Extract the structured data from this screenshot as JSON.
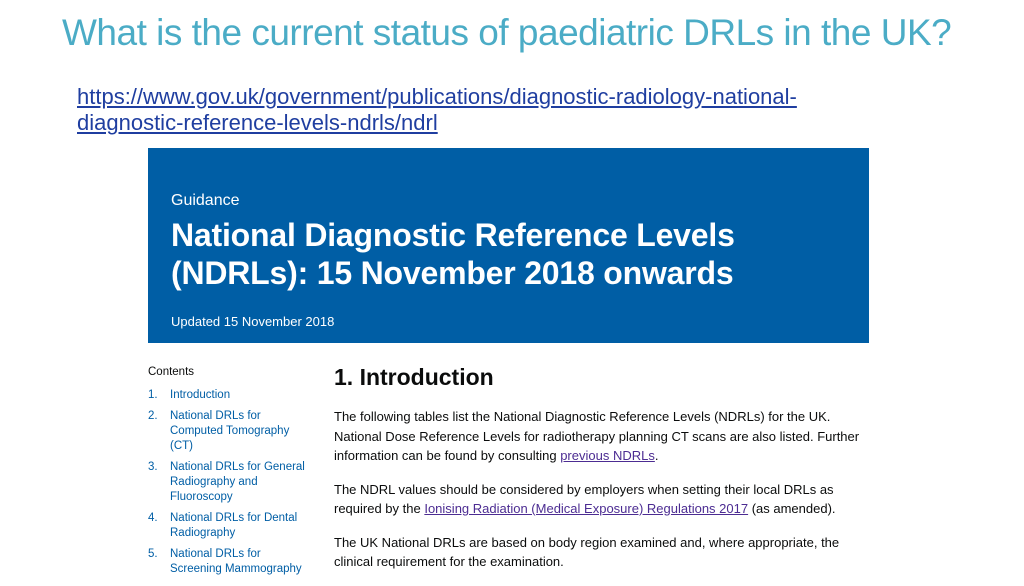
{
  "slide": {
    "title": "What is the current status of paediatric DRLs in the UK?",
    "link": "https://www.gov.uk/government/publications/diagnostic-radiology-national-diagnostic-reference-levels-ndrls/ndrl"
  },
  "banner": {
    "kicker": "Guidance",
    "title": "National Diagnostic Reference Levels (NDRLs): 15 November 2018 onwards",
    "updated": "Updated 15 November 2018",
    "color": "#005ea5"
  },
  "contents": {
    "heading": "Contents",
    "items": [
      {
        "num": "1.",
        "label": "Introduction"
      },
      {
        "num": "2.",
        "label": "National DRLs for Computed Tomography (CT)"
      },
      {
        "num": "3.",
        "label": "National DRLs for General Radiography and Fluoroscopy"
      },
      {
        "num": "4.",
        "label": "National DRLs for Dental Radiography"
      },
      {
        "num": "5.",
        "label": "National DRLs for Screening Mammography"
      }
    ]
  },
  "main": {
    "heading": "1. Introduction",
    "p1_text": "The following tables list the National Diagnostic Reference Levels (NDRLs) for the UK. National Dose Reference Levels for radiotherapy planning CT scans are also listed. Further information can be found by consulting ",
    "p1_link": "previous NDRLs",
    "p1_end": ".",
    "p2_text": "The NDRL values should be considered by employers when setting their local DRLs as required by the ",
    "p2_link": "Ionising Radiation (Medical Exposure) Regulations 2017",
    "p2_end": " (as amended).",
    "p3_text": "The UK National DRLs are based on body region examined and, where appropriate, the clinical requirement for the examination."
  }
}
